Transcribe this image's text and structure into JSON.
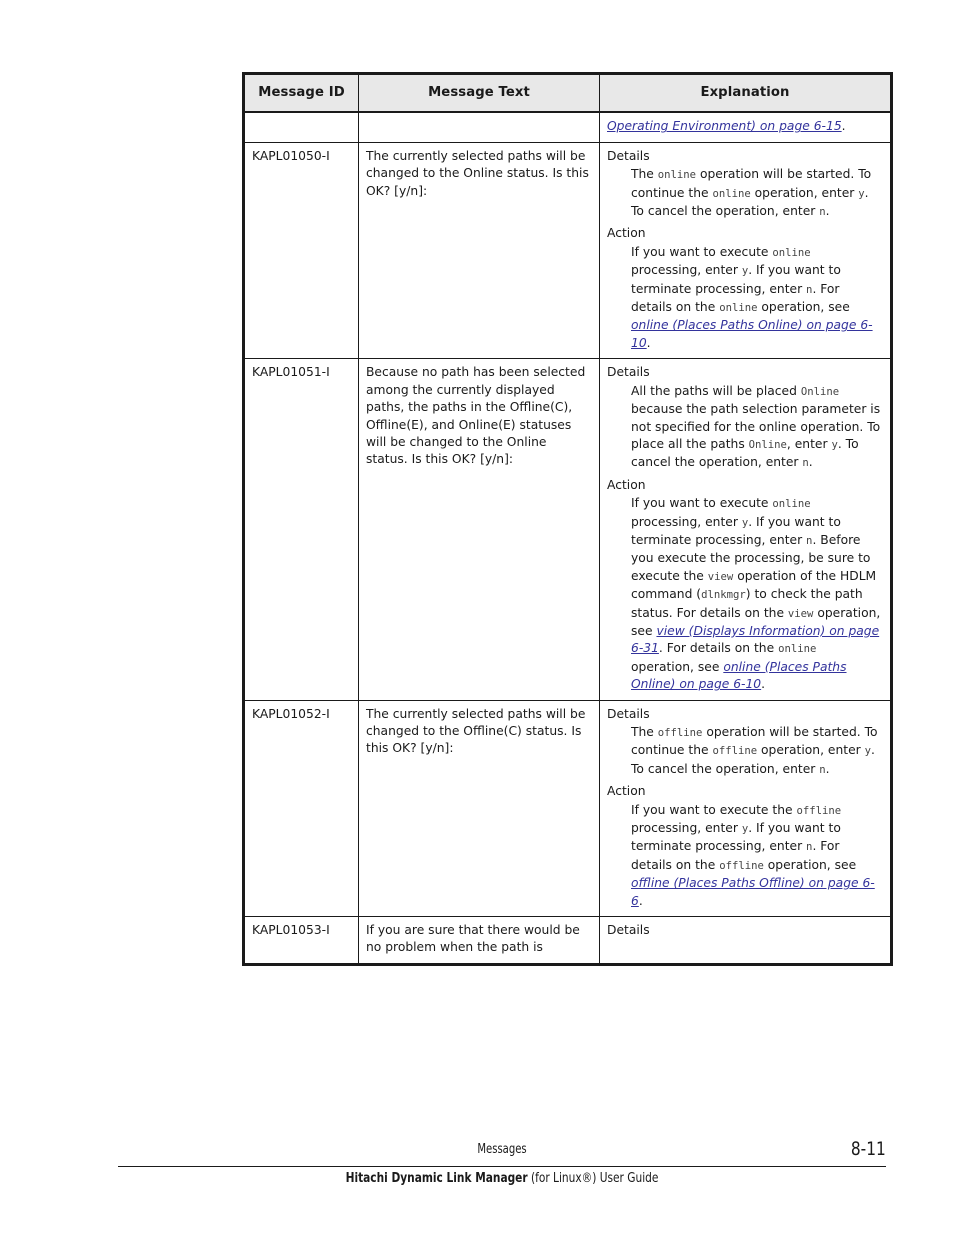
{
  "document": {
    "table": {
      "headers": [
        "Message ID",
        "Message Text",
        "Explanation"
      ],
      "rows": [
        {
          "id": "",
          "text": "",
          "continuation": true,
          "explanation_parts": [
            {
              "kind": "xref",
              "value": "Operating Environment) on page 6-15"
            },
            {
              "kind": "plain",
              "value": "."
            }
          ]
        },
        {
          "id": "KAPL01050-I",
          "text": "The currently selected paths will be changed to the Online status. Is this OK? [y/n]:",
          "details_label": "Details",
          "details_parts": [
            {
              "kind": "plain",
              "value": "The "
            },
            {
              "kind": "mono",
              "value": "online"
            },
            {
              "kind": "plain",
              "value": " operation will be started. To continue the "
            },
            {
              "kind": "mono",
              "value": "online"
            },
            {
              "kind": "plain",
              "value": " operation, enter "
            },
            {
              "kind": "mono",
              "value": "y"
            },
            {
              "kind": "plain",
              "value": ". To cancel the operation, enter "
            },
            {
              "kind": "mono",
              "value": "n"
            },
            {
              "kind": "plain",
              "value": "."
            }
          ],
          "action_label": "Action",
          "action_parts": [
            {
              "kind": "plain",
              "value": "If you want to execute "
            },
            {
              "kind": "mono",
              "value": "online"
            },
            {
              "kind": "plain",
              "value": " processing, enter "
            },
            {
              "kind": "mono",
              "value": "y"
            },
            {
              "kind": "plain",
              "value": ". If you want to terminate processing, enter "
            },
            {
              "kind": "mono",
              "value": "n"
            },
            {
              "kind": "plain",
              "value": ". For details on the "
            },
            {
              "kind": "mono",
              "value": "online"
            },
            {
              "kind": "plain",
              "value": " operation, see "
            },
            {
              "kind": "xref",
              "value": "online (Places Paths Online) on page 6-10"
            },
            {
              "kind": "plain",
              "value": "."
            }
          ]
        },
        {
          "id": "KAPL01051-I",
          "text": "Because no path has been selected among the currently displayed paths, the paths in the Offline(C), Offline(E), and Online(E) statuses will be changed to the Online status. Is this OK? [y/n]:",
          "details_label": "Details",
          "details_parts": [
            {
              "kind": "plain",
              "value": "All the paths will be placed "
            },
            {
              "kind": "mono",
              "value": "Online"
            },
            {
              "kind": "plain",
              "value": " because the path selection parameter is not specified for the online operation. To place all the paths "
            },
            {
              "kind": "mono",
              "value": "Online"
            },
            {
              "kind": "plain",
              "value": ", enter "
            },
            {
              "kind": "mono",
              "value": "y"
            },
            {
              "kind": "plain",
              "value": ". To cancel the operation, enter "
            },
            {
              "kind": "mono",
              "value": "n"
            },
            {
              "kind": "plain",
              "value": "."
            }
          ],
          "action_label": "Action",
          "action_parts": [
            {
              "kind": "plain",
              "value": "If you want to execute "
            },
            {
              "kind": "mono",
              "value": "online"
            },
            {
              "kind": "plain",
              "value": " processing, enter "
            },
            {
              "kind": "mono",
              "value": "y"
            },
            {
              "kind": "plain",
              "value": ". If you want to terminate processing, enter "
            },
            {
              "kind": "mono",
              "value": "n"
            },
            {
              "kind": "plain",
              "value": ". Before you execute the processing, be sure to execute the "
            },
            {
              "kind": "mono",
              "value": "view"
            },
            {
              "kind": "plain",
              "value": " operation of the HDLM command ("
            },
            {
              "kind": "mono",
              "value": "dlnkmgr"
            },
            {
              "kind": "plain",
              "value": ") to check the path status. For details on the "
            },
            {
              "kind": "mono",
              "value": "view"
            },
            {
              "kind": "plain",
              "value": " operation, see "
            },
            {
              "kind": "xref",
              "value": "view (Displays Information) on page 6-31"
            },
            {
              "kind": "plain",
              "value": ". For details on the "
            },
            {
              "kind": "mono",
              "value": "online"
            },
            {
              "kind": "plain",
              "value": " operation, see "
            },
            {
              "kind": "xref",
              "value": "online (Places Paths Online) on page 6-10"
            },
            {
              "kind": "plain",
              "value": "."
            }
          ]
        },
        {
          "id": "KAPL01052-I",
          "text": "The currently selected paths will be changed to the Offline(C) status. Is this OK? [y/n]:",
          "details_label": "Details",
          "details_parts": [
            {
              "kind": "plain",
              "value": "The "
            },
            {
              "kind": "mono",
              "value": "offline"
            },
            {
              "kind": "plain",
              "value": " operation will be started. To continue the "
            },
            {
              "kind": "mono",
              "value": "offline"
            },
            {
              "kind": "plain",
              "value": " operation, enter "
            },
            {
              "kind": "mono",
              "value": "y"
            },
            {
              "kind": "plain",
              "value": ". To cancel the operation, enter "
            },
            {
              "kind": "mono",
              "value": "n"
            },
            {
              "kind": "plain",
              "value": "."
            }
          ],
          "action_label": "Action",
          "action_parts": [
            {
              "kind": "plain",
              "value": "If you want to execute the "
            },
            {
              "kind": "mono",
              "value": "offline"
            },
            {
              "kind": "plain",
              "value": " processing, enter "
            },
            {
              "kind": "mono",
              "value": "y"
            },
            {
              "kind": "plain",
              "value": ". If you want to terminate processing, enter "
            },
            {
              "kind": "mono",
              "value": "n"
            },
            {
              "kind": "plain",
              "value": ". For details on the "
            },
            {
              "kind": "mono",
              "value": "offline"
            },
            {
              "kind": "plain",
              "value": " operation, see "
            },
            {
              "kind": "xref",
              "value": "offline (Places Paths Offline) on page 6-6"
            },
            {
              "kind": "plain",
              "value": "."
            }
          ]
        },
        {
          "id": "KAPL01053-I",
          "text": "If you are sure that there would be no problem when the path is",
          "details_label": "Details",
          "truncated": true
        }
      ]
    }
  },
  "footer": {
    "chapter": "Messages",
    "page_number": "8-11",
    "title_bold": "Hitachi Dynamic Link Manager",
    "title_rest": " (for Linux®) User Guide"
  },
  "colors": {
    "text": "#1a1a1a",
    "link": "#33339c",
    "mono": "#444444",
    "header_bg": "#e8e8e8",
    "border": "#1a1a1a"
  }
}
